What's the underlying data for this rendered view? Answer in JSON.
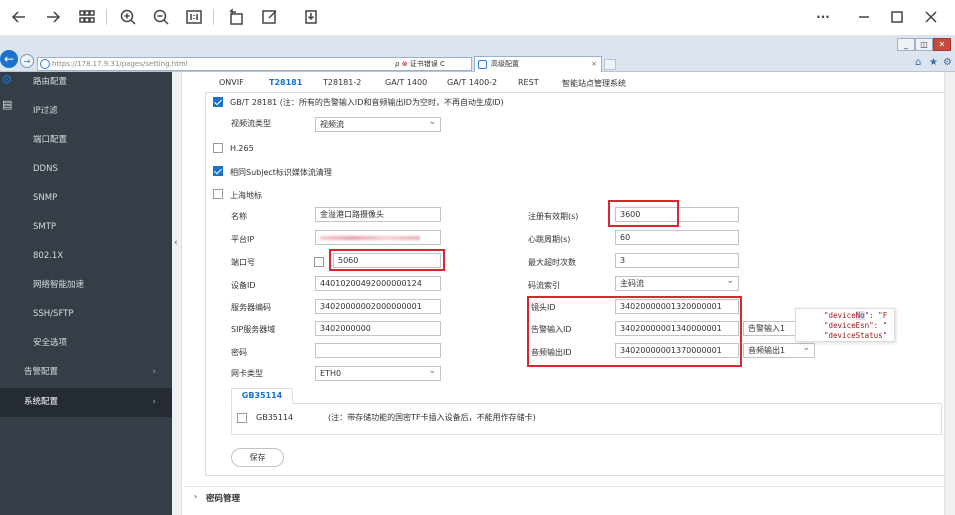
{
  "viewer": {
    "icons": [
      "back-arrow-icon",
      "forward-arrow-icon",
      "grid-icon",
      "zoom-in-icon",
      "zoom-out-icon",
      "actual-size-icon",
      "rotate-icon",
      "edit-icon",
      "save-icon",
      "more-icon",
      "minimize-icon",
      "maximize-icon",
      "close-icon"
    ],
    "more_label": "···"
  },
  "browser": {
    "url": "https://178.17.9.31/pages/setting.html",
    "search_glyph": "ρ",
    "cert_x": "⊗",
    "cert_error": "证书错误",
    "refresh_glyph": "C",
    "tab_title": "高级配置",
    "tab_close": "×",
    "win_minimize": "_",
    "win_restore": "◫",
    "win_close": "✕",
    "tools": [
      "⌂",
      "★",
      "⚙"
    ]
  },
  "sidebar": {
    "items": [
      {
        "label": "路由配置"
      },
      {
        "label": "IP过滤"
      },
      {
        "label": "端口配置"
      },
      {
        "label": "DDNS"
      },
      {
        "label": "SNMP"
      },
      {
        "label": "SMTP"
      },
      {
        "label": "802.1X"
      },
      {
        "label": "网络智能加速"
      },
      {
        "label": "SSH/SFTP"
      },
      {
        "label": "安全选项"
      }
    ],
    "groups": [
      {
        "label": "告警配置",
        "arrow": "›"
      },
      {
        "label": "系统配置",
        "arrow": "›"
      }
    ],
    "collapse_glyph": "‹"
  },
  "tabs": [
    "ONVIF",
    "T28181",
    "T28181-2",
    "GA/T 1400",
    "GA/T 1400-2",
    "REST",
    "智能站点管理系统"
  ],
  "form": {
    "gb28181_label": "GB/T 28181 (注：所有的告警输入ID和音频输出ID为空时，不再自动生成ID)",
    "stream_type_label": "视频流类型",
    "stream_type_value": "视频流",
    "h265_label": "H.265",
    "subject_label": "相同Subject标识媒体流清理",
    "shanghai_label": "上海地标",
    "name_label": "名称",
    "name_value": "金溢港口路摄像头",
    "platform_ip_label": "平台IP",
    "port_label": "端口号",
    "port_value": "5060",
    "device_id_label": "设备ID",
    "device_id_value": "44010200492000000124",
    "server_code_label": "服务器编码",
    "server_code_value": "34020000002000000001",
    "sip_domain_label": "SIP服务器域",
    "sip_domain_value": "3402000000",
    "password_label": "密码",
    "nic_type_label": "网卡类型",
    "nic_type_value": "ETH0",
    "reg_valid_label": "注册有效期(s)",
    "reg_valid_value": "3600",
    "heartbeat_label": "心跳周期(s)",
    "heartbeat_value": "60",
    "max_timeout_label": "最大超时次数",
    "max_timeout_value": "3",
    "stream_index_label": "码流索引",
    "stream_index_value": "主码流",
    "camera_id_label": "镜头ID",
    "camera_id_value": "34020000001320000001",
    "alarm_in_label": "告警输入ID",
    "alarm_in_value": "34020000001340000001",
    "alarm_in_select": "告警输入1",
    "audio_out_label": "音频输出ID",
    "audio_out_value": "34020000001370000001",
    "audio_out_select": "音频输出1",
    "gb_tab": "GB35114",
    "gb_label": "GB35114",
    "gb_note": "(注：带存储功能的国密TF卡插入设备后，不能用作存储卡)",
    "save_label": "保存"
  },
  "bottom": {
    "chevron": "›",
    "title": "密码管理"
  },
  "code_overlay": {
    "line1_a": "\"device",
    "line1_hl": "No",
    "line1_b": "\": \"F",
    "line2": "\"deviceEsn\": \"",
    "line3": "\"deviceStatus\""
  }
}
